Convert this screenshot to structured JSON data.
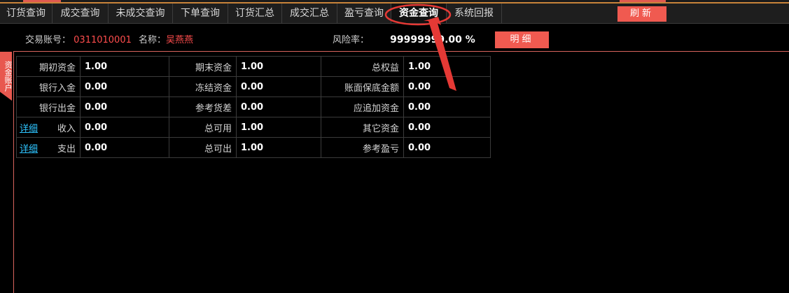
{
  "tabs": [
    {
      "label": "订货查询"
    },
    {
      "label": "成交查询"
    },
    {
      "label": "未成交查询"
    },
    {
      "label": "下单查询"
    },
    {
      "label": "订货汇总"
    },
    {
      "label": "成交汇总"
    },
    {
      "label": "盈亏查询"
    },
    {
      "label": "资金查询"
    },
    {
      "label": "系统回报"
    }
  ],
  "refresh_label": "刷新",
  "account": {
    "account_label": "交易账号：",
    "account_value": "0311010001",
    "name_label": "名称：",
    "name_value": "吴燕燕",
    "risk_label": "风险率：",
    "risk_value": "99999999.00 %"
  },
  "detail_button_label": "明细",
  "side_tab_label": "资金账户",
  "detail_link": "详细",
  "funds": {
    "rows": [
      [
        {
          "label": "期初资金",
          "value": "1.00"
        },
        {
          "label": "期末资金",
          "value": "1.00"
        },
        {
          "label": "总权益",
          "value": "1.00"
        }
      ],
      [
        {
          "label": "银行入金",
          "value": "0.00"
        },
        {
          "label": "冻结资金",
          "value": "0.00"
        },
        {
          "label": "账面保底金额",
          "value": "0.00"
        }
      ],
      [
        {
          "label": "银行出金",
          "value": "0.00"
        },
        {
          "label": "参考货差",
          "value": "0.00"
        },
        {
          "label": "应追加资金",
          "value": "0.00"
        }
      ],
      [
        {
          "label": "收入",
          "value": "0.00"
        },
        {
          "label": "总可用",
          "value": "1.00"
        },
        {
          "label": "其它资金",
          "value": "0.00"
        }
      ],
      [
        {
          "label": "支出",
          "value": "0.00"
        },
        {
          "label": "总可出",
          "value": "1.00"
        },
        {
          "label": "参考盈亏",
          "value": "0.00"
        }
      ]
    ]
  },
  "colors": {
    "accent": "#f05a50",
    "link": "#2ec4ff",
    "annotation": "#e53935",
    "value_red": "#ff4d4d"
  }
}
